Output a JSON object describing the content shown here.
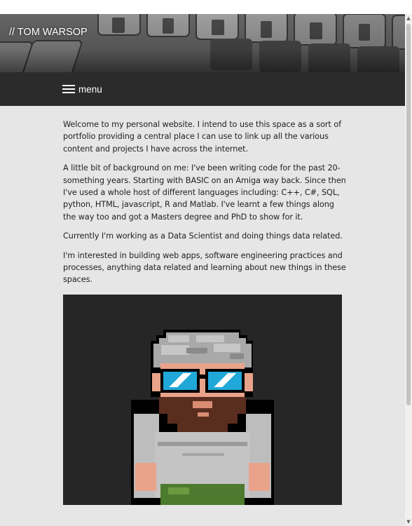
{
  "header": {
    "site_title": "// TOM WARSOP"
  },
  "nav": {
    "menu_label": "menu",
    "menu_icon": "hamburger-icon"
  },
  "content": {
    "paragraphs": [
      "Welcome to my personal website. I intend to use this space as a sort of portfolio providing a central place I can use to link up all the various content and projects I have across the internet.",
      "A little bit of background on me: I've been writing code for the past 20-something years. Starting with BASIC on an Amiga way back. Since then I've used a whole host of different languages including: C++, C#, SQL, python, HTML, javascript, R and Matlab. I've learnt a few things along the way too and got a Masters degree and PhD to show for it.",
      "Currently I'm working as a Data Scientist and doing things data related.",
      "I'm interested in building web apps, software engineering practices and processes, anything data related and learning about new things in these spaces."
    ],
    "avatar_icon": "pixel-art-avatar-icon"
  },
  "colors": {
    "page_bg": "#e6e6e6",
    "navbar_bg": "#2b2b2b",
    "avatar_bg": "#262626",
    "text": "#222222"
  }
}
